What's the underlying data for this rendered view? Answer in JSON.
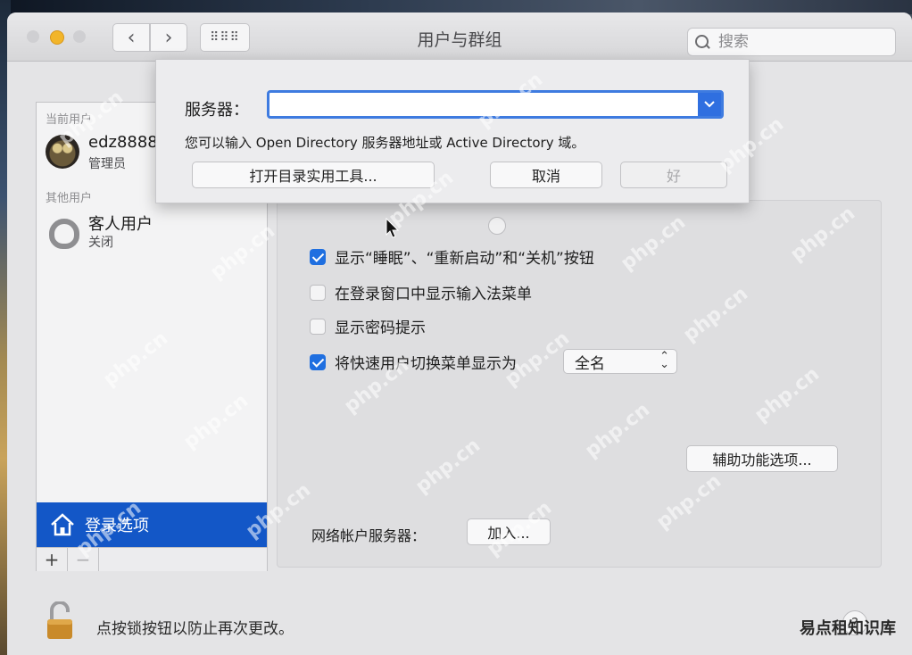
{
  "window": {
    "title": "用户与群组",
    "search_placeholder": "搜索"
  },
  "sidebar": {
    "current_users_label": "当前用户",
    "current_user": {
      "name": "edz8888",
      "role": "管理员"
    },
    "other_users_label": "其他用户",
    "other_user": {
      "name": "客人用户",
      "status": "关闭"
    },
    "login_options_label": "登录选项",
    "add_label": "+",
    "remove_label": "−"
  },
  "dialog": {
    "server_label": "服务器：",
    "server_value": "",
    "hint": "您可以输入 Open Directory 服务器地址或 Active Directory 域。",
    "open_utility_label": "打开目录实用工具...",
    "cancel_label": "取消",
    "ok_label": "好"
  },
  "options": {
    "show_sleep_restart": {
      "label": "显示“睡眠”、“重新启动”和“关机”按钮",
      "checked": true
    },
    "show_input_menu": {
      "label": "在登录窗口中显示输入法菜单",
      "checked": false
    },
    "show_password_hints": {
      "label": "显示密码提示",
      "checked": false
    },
    "fast_user_switching": {
      "label": "将快速用户切换菜单显示为",
      "checked": true,
      "selected": "全名"
    },
    "accessibility_button": "辅助功能选项...",
    "network_server_label": "网络帐户服务器：",
    "join_button": "加入..."
  },
  "footer": {
    "lock_text": "点按锁按钮以防止再次更改。",
    "help": "?",
    "corner_watermark": "易点租知识库"
  },
  "watermark_text": "php.cn",
  "colors": {
    "accent_blue": "#1357c7",
    "checkbox_blue": "#1f6fe0",
    "lock_gold": "#c98a2a"
  }
}
